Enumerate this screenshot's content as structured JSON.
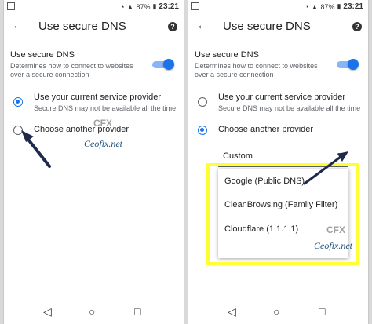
{
  "status_bar": {
    "battery": "87%",
    "time": "23:21"
  },
  "left_screen": {
    "title": "Use secure DNS",
    "setting": {
      "title": "Use secure DNS",
      "description": "Determines how to connect to websites over a secure connection"
    },
    "options": [
      {
        "label": "Use your current service provider",
        "description": "Secure DNS may not be available all the time",
        "checked": true
      },
      {
        "label": "Choose another provider",
        "checked": false
      }
    ],
    "watermark": "Ceofix.net",
    "watermark_logo": "CFX"
  },
  "right_screen": {
    "title": "Use secure DNS",
    "setting": {
      "title": "Use secure DNS",
      "description": "Determines how to connect to websites over a secure connection"
    },
    "options": [
      {
        "label": "Use your current service provider",
        "description": "Secure DNS may not be available all the time",
        "checked": false
      },
      {
        "label": "Choose another provider",
        "checked": true
      }
    ],
    "dropdown_value": "Custom",
    "menu_items": [
      "Google (Public DNS)",
      "CleanBrowsing (Family Filter)",
      "Cloudflare (1.1.1.1)"
    ],
    "watermark": "Ceofix.net",
    "watermark_logo": "CFX"
  },
  "colors": {
    "accent": "#1a73e8",
    "highlight": "#ffff33",
    "arrow": "#1f2a4a"
  },
  "icons": [
    "back-arrow-icon",
    "help-icon",
    "wifi-icon",
    "battery-icon",
    "nav-back-icon",
    "nav-home-icon",
    "nav-recents-icon"
  ]
}
